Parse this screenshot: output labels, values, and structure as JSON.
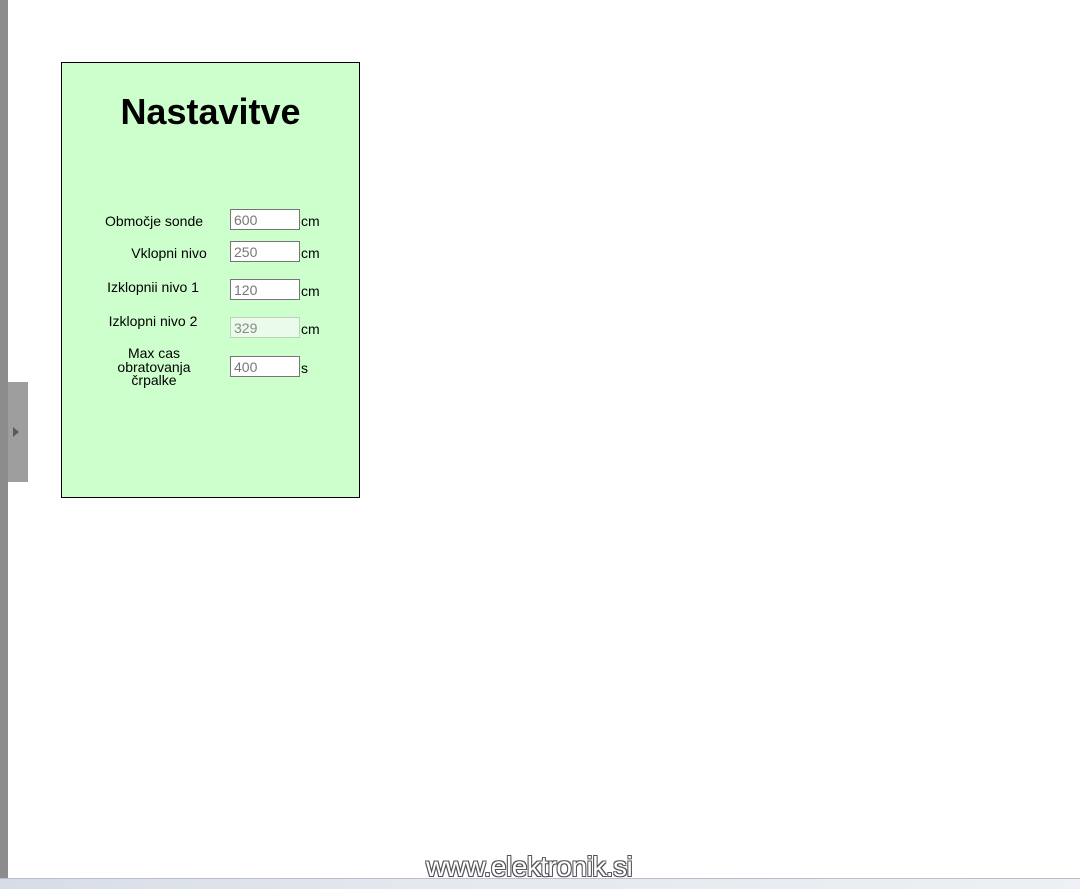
{
  "settings": {
    "title": "Nastavitve",
    "rows": [
      {
        "label": "Območje sonde",
        "value": "600",
        "unit": "cm",
        "disabled": false
      },
      {
        "label": "Vklopni nivo",
        "value": "250",
        "unit": "cm",
        "disabled": false
      },
      {
        "label": "Izklopnii nivo 1",
        "value": "120",
        "unit": "cm",
        "disabled": false
      },
      {
        "label": "Izklopni nivo 2",
        "value": "329",
        "unit": "cm",
        "disabled": true
      },
      {
        "label": "Max cas obratovanja črpalke",
        "value": "400",
        "unit": "s",
        "disabled": false
      }
    ]
  },
  "watermark": "www.elektronik.si",
  "colors": {
    "panel_bg": "#ccffcc",
    "page_bg": "#ffffff"
  },
  "icons": {
    "side_handle": "chevron-right-icon"
  }
}
